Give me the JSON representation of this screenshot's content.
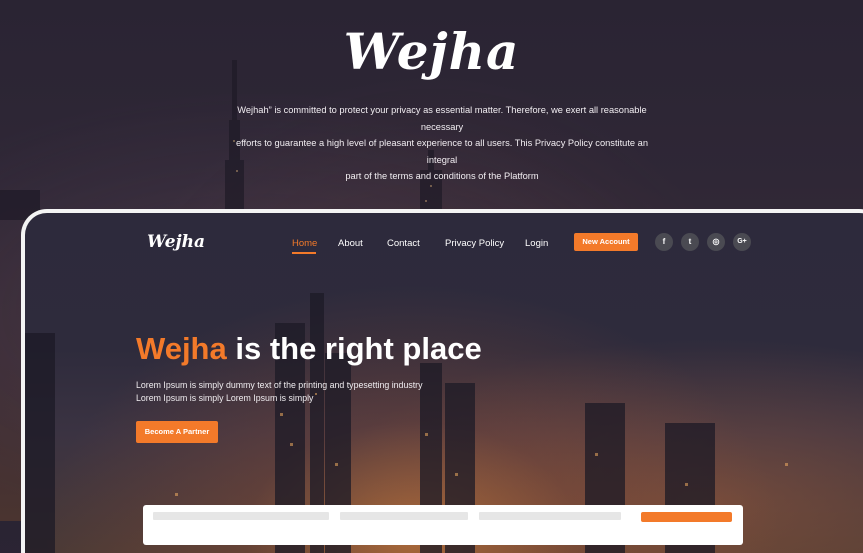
{
  "top": {
    "logo": "Wejha",
    "intro_line1": "Wejhah” is committed to protect your privacy as essential matter. Therefore, we exert all reasonable necessary",
    "intro_line2": "efforts to guarantee a high level of pleasant experience to all users. This Privacy Policy constitute an integral",
    "intro_line3": "part of the terms and conditions of the Platform"
  },
  "nav": {
    "logo": "Wejha",
    "items": [
      {
        "label": "Home",
        "active": true
      },
      {
        "label": "About"
      },
      {
        "label": "Contact"
      },
      {
        "label": "Privacy Policy"
      },
      {
        "label": "Login"
      }
    ],
    "cta": "New Account",
    "social": [
      {
        "icon": "facebook-icon",
        "glyph": "f"
      },
      {
        "icon": "twitter-icon",
        "glyph": "t"
      },
      {
        "icon": "instagram-icon",
        "glyph": "◎"
      },
      {
        "icon": "google-plus-icon",
        "glyph": "G+"
      }
    ]
  },
  "hero": {
    "title_accent": "Wejha",
    "title_rest": " is the right place",
    "subtitle_line1": "Lorem Ipsum is simply dummy text of the printing and typesetting industry",
    "subtitle_line2": "Lorem Ipsum is simply Lorem Ipsum is simply",
    "button": "Become A Partner"
  },
  "colors": {
    "accent": "#f37a2a",
    "background": "#2e2838",
    "social_bg": "#4a4a52"
  }
}
